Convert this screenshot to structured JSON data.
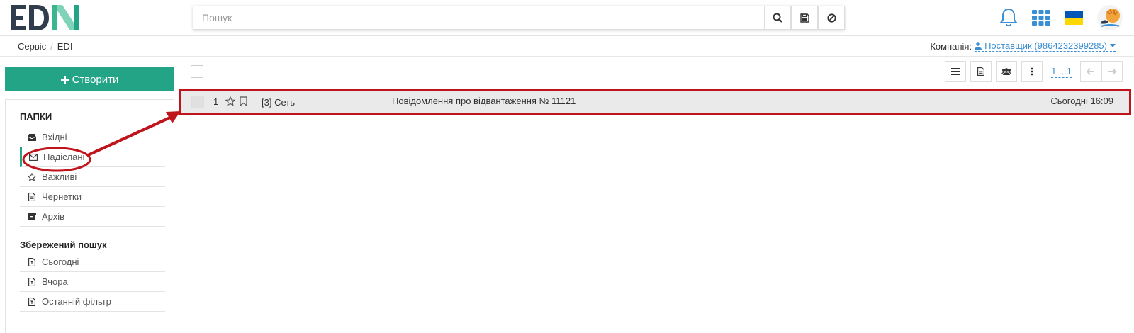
{
  "app": {
    "logo_text": "EDIN"
  },
  "search": {
    "placeholder": "Пошук"
  },
  "breadcrumb": {
    "items": [
      "Сервіс",
      "EDI"
    ],
    "separator": "/"
  },
  "company": {
    "label": "Компанія:",
    "value": "Поставщик (9864232399285)"
  },
  "sidebar": {
    "create_label": "Створити",
    "folders_title": "ПАПКИ",
    "folders": [
      {
        "label": "Вхідні",
        "icon": "inbox-icon"
      },
      {
        "label": "Надіслані",
        "icon": "envelope-icon"
      },
      {
        "label": "Важливі",
        "icon": "star-icon"
      },
      {
        "label": "Чернетки",
        "icon": "document-icon"
      },
      {
        "label": "Архів",
        "icon": "archive-icon"
      }
    ],
    "saved_title": "Збережений пошук",
    "saved": [
      {
        "label": "Сьогодні",
        "icon": "filter-doc-icon"
      },
      {
        "label": "Вчора",
        "icon": "filter-doc-icon"
      },
      {
        "label": "Останній фільтр",
        "icon": "filter-doc-icon"
      }
    ]
  },
  "toolbar": {
    "pager": "1 ...1"
  },
  "messages": [
    {
      "num": "1",
      "sender": "[3] Сеть",
      "subject": "Повідомлення про відвантаження № 11121",
      "date": "Сьогодні 16:09"
    }
  ],
  "colors": {
    "accent": "#23a486",
    "link": "#3a8fd4",
    "annotation": "#c0141c"
  }
}
